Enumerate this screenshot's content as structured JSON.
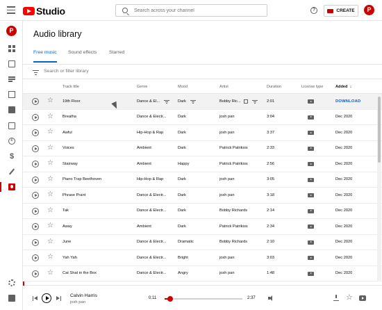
{
  "header": {
    "logo_text": "Studio",
    "search_placeholder": "Search across your channel",
    "create_label": "CREATE",
    "avatar_letter": "P"
  },
  "sidebar": {
    "avatar_letter": "P",
    "items": [
      "dashboard-icon",
      "content-icon",
      "playlists-icon",
      "analytics-icon",
      "comments-icon",
      "subtitles-icon",
      "copyright-icon",
      "monetization-icon",
      "customization-icon",
      "audio-library-icon",
      "settings-icon",
      "feedback-icon"
    ]
  },
  "page": {
    "title": "Audio library",
    "tabs": [
      {
        "label": "Free music",
        "active": true
      },
      {
        "label": "Sound effects",
        "active": false
      },
      {
        "label": "Starred",
        "active": false
      }
    ],
    "filter_placeholder": "Search or filter library"
  },
  "table": {
    "columns": {
      "track_title": "Track title",
      "genre": "Genre",
      "mood": "Mood",
      "artist": "Artist",
      "duration": "Duration",
      "license_type": "License type",
      "added": "Added"
    },
    "download_label": "DOWNLOAD",
    "rows": [
      {
        "title": "19th Floor",
        "genre": "Dance & El...",
        "mood": "Dark",
        "artist": "Bobby Ric...",
        "duration": "2:01",
        "added": ""
      },
      {
        "title": "Breatha",
        "genre": "Dance & Electr...",
        "mood": "Dark",
        "artist": "josh pan",
        "duration": "3:04",
        "added": "Dec 2020"
      },
      {
        "title": "Awful",
        "genre": "Hip-Hop & Rap",
        "mood": "Dark",
        "artist": "josh pan",
        "duration": "3:37",
        "added": "Dec 2020"
      },
      {
        "title": "Voices",
        "genre": "Ambient",
        "mood": "Dark",
        "artist": "Patrick Patrikios",
        "duration": "2:33",
        "added": "Dec 2020"
      },
      {
        "title": "Stairway",
        "genre": "Ambient",
        "mood": "Happy",
        "artist": "Patrick Patrikios",
        "duration": "2:56",
        "added": "Dec 2020"
      },
      {
        "title": "Piano Trap Beethoven",
        "genre": "Hip-Hop & Rap",
        "mood": "Dark",
        "artist": "josh pan",
        "duration": "3:05",
        "added": "Dec 2020"
      },
      {
        "title": "Phrase Prant",
        "genre": "Dance & Electr...",
        "mood": "Dark",
        "artist": "josh pan",
        "duration": "3:18",
        "added": "Dec 2020"
      },
      {
        "title": "Tak",
        "genre": "Dance & Electr...",
        "mood": "Dark",
        "artist": "Bobby Richards",
        "duration": "2:14",
        "added": "Dec 2020"
      },
      {
        "title": "Away",
        "genre": "Ambient",
        "mood": "Dark",
        "artist": "Patrick Patrikios",
        "duration": "2:34",
        "added": "Dec 2020"
      },
      {
        "title": "June",
        "genre": "Dance & Electr...",
        "mood": "Dramatic",
        "artist": "Bobby Richards",
        "duration": "2:10",
        "added": "Dec 2020"
      },
      {
        "title": "Yah Yah",
        "genre": "Dance & Electr...",
        "mood": "Bright",
        "artist": "josh pan",
        "duration": "3:03",
        "added": "Dec 2020"
      },
      {
        "title": "Cat Shat in the Box",
        "genre": "Dance & Electr...",
        "mood": "Angry",
        "artist": "josh pan",
        "duration": "1:48",
        "added": "Dec 2020"
      }
    ]
  },
  "player": {
    "title": "Calvin Harris",
    "artist": "josh pan",
    "elapsed": "0:11",
    "total": "2:37",
    "progress_fraction": 0.07
  },
  "colors": {
    "accent": "#065fd4",
    "brand": "#ff0000",
    "active_red": "#cc0000"
  }
}
